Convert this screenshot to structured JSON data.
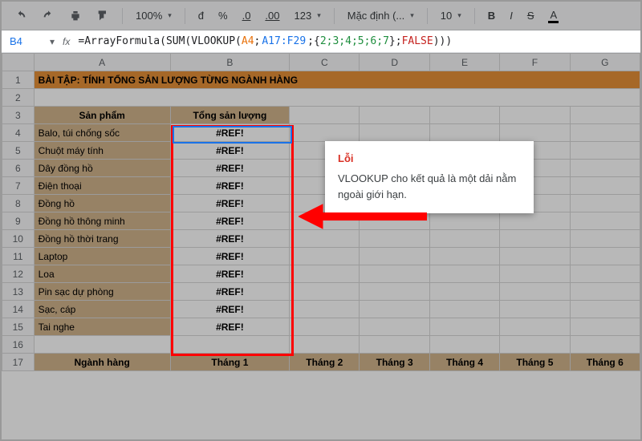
{
  "toolbar": {
    "zoom": "100%",
    "currency": "đ",
    "percent": "%",
    "dec_dec": ".0",
    "dec_inc": ".00",
    "num_format": "123",
    "font": "Mặc định (...",
    "font_size": "10",
    "bold": "B",
    "italic": "I",
    "strike": "S",
    "textcolor": "A"
  },
  "fx": {
    "cell_ref": "B4",
    "fx_label": "fx",
    "pre": "=ArrayFormula(SUM(VLOOKUP(",
    "a4": "A4",
    "sep1": ";",
    "range": "A17:F29",
    "sep2": ";{",
    "arr": "2;3;4;5;6;7",
    "sep3": "};",
    "false_kw": "FALSE",
    "post": ")))"
  },
  "cols": [
    "A",
    "B",
    "C",
    "D",
    "E",
    "F",
    "G"
  ],
  "rows": [
    "1",
    "2",
    "3",
    "4",
    "5",
    "6",
    "7",
    "8",
    "9",
    "10",
    "11",
    "12",
    "13",
    "14",
    "15",
    "16",
    "17"
  ],
  "title": "BÀI TẬP: TÍNH TỔNG SẢN LƯỢNG TỪNG NGÀNH HÀNG",
  "header_product": "Sản phẩm",
  "header_total": "Tổng sản lượng",
  "products": [
    "Balo, túi chống sốc",
    "Chuột máy tính",
    "Dây đồng hồ",
    "Điện thoại",
    "Đồng hồ",
    "Đồng hồ thông minh",
    "Đồng hồ thời trang",
    "Laptop",
    "Loa",
    "Pin sạc dự phòng",
    "Sạc, cáp",
    "Tai nghe"
  ],
  "ref_err": "#REF!",
  "header_category": "Ngành hàng",
  "months": [
    "Tháng 1",
    "Tháng  2",
    "Tháng 3",
    "Tháng 4",
    "Tháng 5",
    "Tháng 6"
  ],
  "tooltip": {
    "title": "Lỗi",
    "msg": "VLOOKUP cho kết quả là một dải nằm ngoài giới hạn."
  }
}
